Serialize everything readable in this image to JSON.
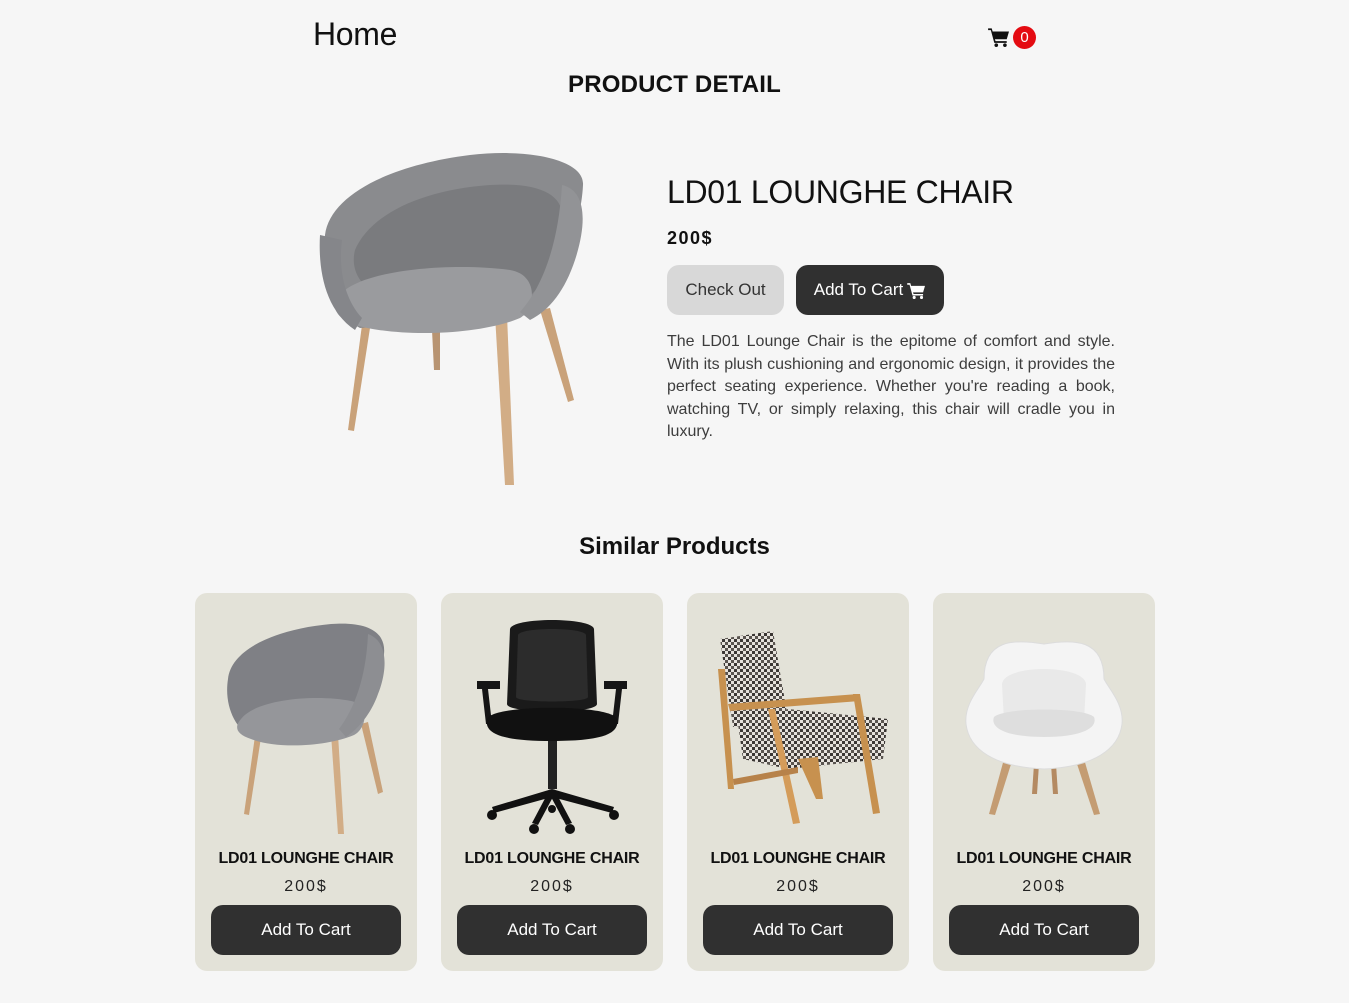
{
  "header": {
    "home_label": "Home",
    "cart_icon": "cart-icon",
    "cart_count": "0",
    "badge_color": "#e40b12"
  },
  "page_title": "PRODUCT DETAIL",
  "product": {
    "name": "LD01 LOUNGHE CHAIR",
    "price": "200$",
    "checkout_label": "Check Out",
    "add_to_cart_label": "Add To Cart",
    "description": "The LD01 Lounge Chair is the epitome of comfort and style. With its plush cushioning and ergonomic design, it provides the perfect seating experience. Whether you're reading a book, watching TV, or simply relaxing, this chair will cradle you in luxury.",
    "image": "grey-lounge-chair"
  },
  "similar": {
    "title": "Similar Products",
    "items": [
      {
        "name": "LD01 LOUNGHE CHAIR",
        "price": "200$",
        "button": "Add To Cart",
        "image": "grey-tub-chair"
      },
      {
        "name": "LD01 LOUNGHE CHAIR",
        "price": "200$",
        "button": "Add To Cart",
        "image": "black-office-chair"
      },
      {
        "name": "LD01 LOUNGHE CHAIR",
        "price": "200$",
        "button": "Add To Cart",
        "image": "houndstooth-armchair"
      },
      {
        "name": "LD01 LOUNGHE CHAIR",
        "price": "200$",
        "button": "Add To Cart",
        "image": "white-lounge-chair"
      }
    ]
  },
  "colors": {
    "background": "#f6f6f6",
    "dark_button": "#303030",
    "light_button": "#d8d8d8",
    "card_background": "#e3e2d8"
  }
}
